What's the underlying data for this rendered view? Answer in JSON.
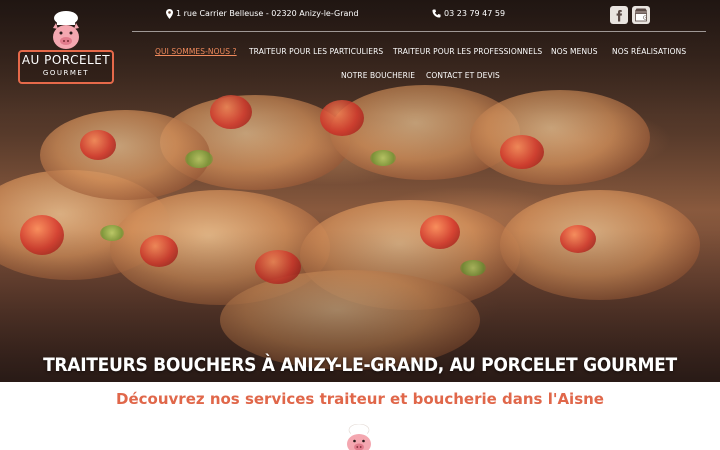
{
  "header": {
    "logo": {
      "name": "AU PORCELET",
      "sub": "GOURMET"
    },
    "address": "1 rue Carrier Belleuse - 02320 Anizy-le-Grand",
    "phone": "03 23 79 47 59",
    "social": [
      {
        "icon": "facebook-icon"
      },
      {
        "icon": "google-my-business-icon"
      }
    ]
  },
  "nav": {
    "items": [
      {
        "label": "QUI SOMMES-NOUS ?",
        "active": true
      },
      {
        "label": "TRAITEUR POUR LES PARTICULIERS"
      },
      {
        "label": "TRAITEUR POUR LES PROFESSIONNELS"
      },
      {
        "label": "NOS MENUS"
      },
      {
        "label": "NOS RÉALISATIONS"
      },
      {
        "label": "NOTRE BOUCHERIE"
      },
      {
        "label": "CONTACT ET DEVIS"
      }
    ]
  },
  "hero": {
    "title": "TRAITEURS BOUCHERS À ANIZY-LE-GRAND, AU PORCELET GOURMET"
  },
  "main": {
    "subtitle": "Découvrez nos services traiteur et boucherie dans l'Aisne"
  },
  "colors": {
    "accent": "#e0674a",
    "nav_active": "#f08a5c",
    "text_light": "#ffffff"
  }
}
